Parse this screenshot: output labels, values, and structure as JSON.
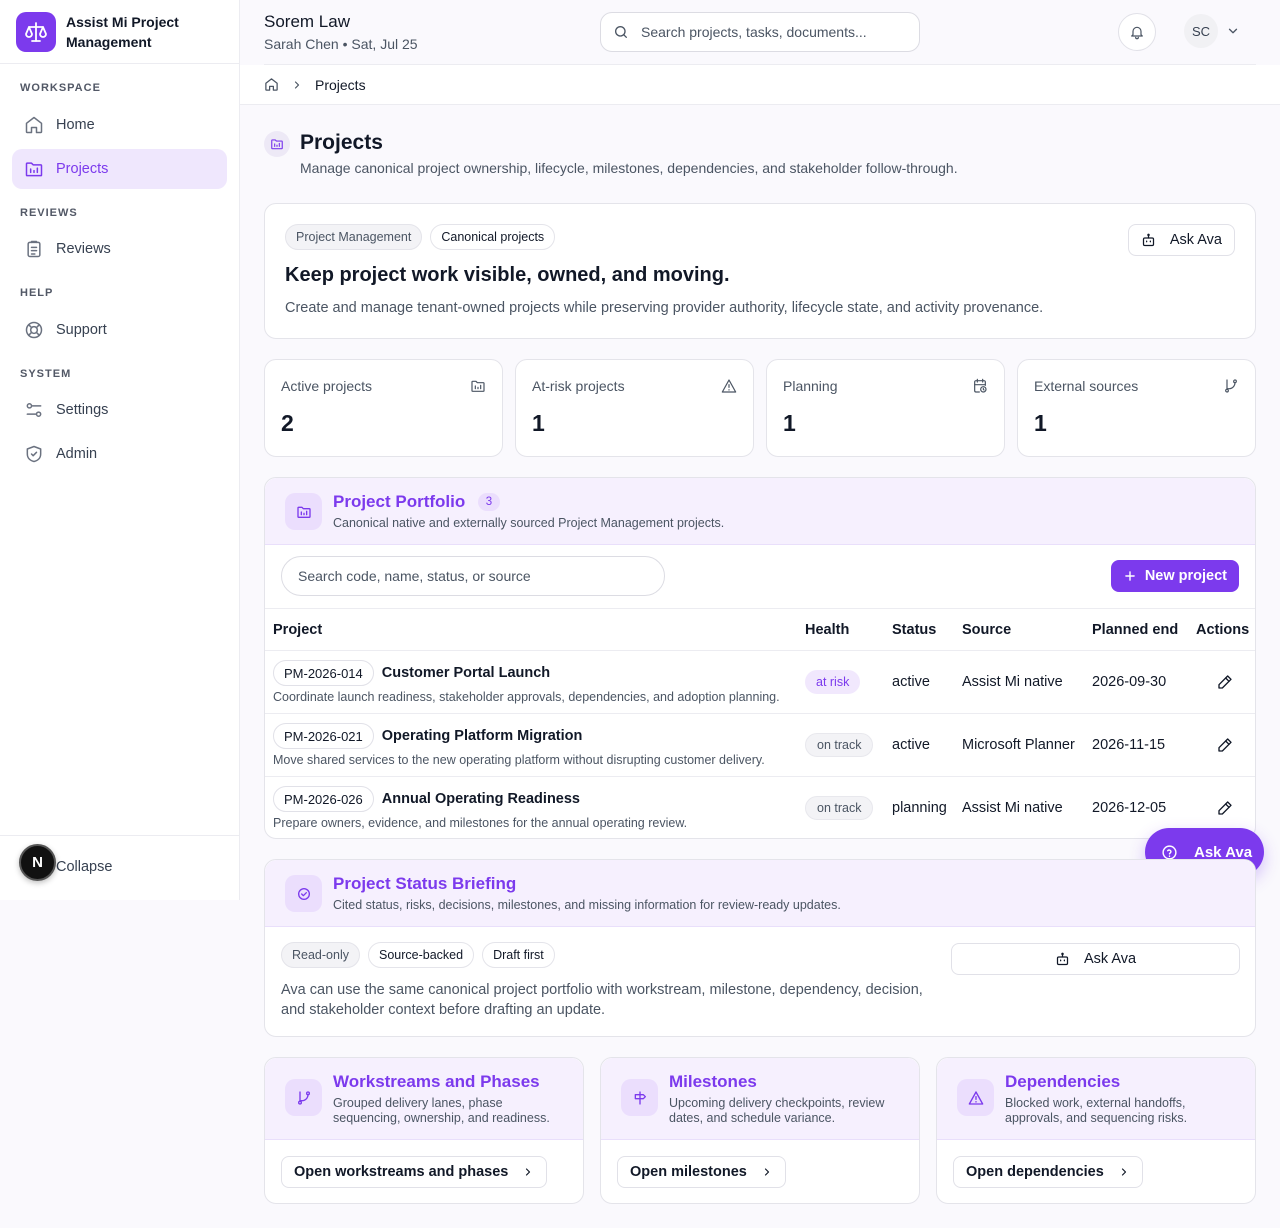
{
  "app": {
    "brand": "Assist Mi Project Management",
    "brand_color": "#7c3aed"
  },
  "sidebar": {
    "sections": [
      {
        "label": "WORKSPACE",
        "items": [
          {
            "label": "Home",
            "icon": "home-icon",
            "active": false
          },
          {
            "label": "Projects",
            "icon": "projects-icon",
            "active": true
          }
        ]
      },
      {
        "label": "REVIEWS",
        "items": [
          {
            "label": "Reviews",
            "icon": "clipboard-icon",
            "active": false
          }
        ]
      },
      {
        "label": "HELP",
        "items": [
          {
            "label": "Support",
            "icon": "lifebuoy-icon",
            "active": false
          }
        ]
      },
      {
        "label": "SYSTEM",
        "items": [
          {
            "label": "Settings",
            "icon": "settings-sliders-icon",
            "active": false
          },
          {
            "label": "Admin",
            "icon": "shield-icon",
            "active": false
          }
        ]
      }
    ],
    "collapse_label": "Collapse",
    "dev_badge": "N"
  },
  "header": {
    "org_name": "Sorem Law",
    "user_meta": "Sarah Chen • Sat, Jul 25",
    "search_placeholder": "Search projects, tasks, documents...",
    "user_initials": "SC"
  },
  "breadcrumb": {
    "current": "Projects"
  },
  "page": {
    "title": "Projects",
    "subtitle": "Manage canonical project ownership, lifecycle, milestones, dependencies, and stakeholder follow-through."
  },
  "hero": {
    "pills": [
      "Project Management",
      "Canonical projects"
    ],
    "heading": "Keep project work visible, owned, and moving.",
    "text": "Create and manage tenant-owned projects while preserving provider authority, lifecycle state, and activity provenance.",
    "ask_label": "Ask Ava"
  },
  "stats": [
    {
      "label": "Active projects",
      "value": "2",
      "icon": "projects-icon"
    },
    {
      "label": "At-risk projects",
      "value": "1",
      "icon": "warning-icon"
    },
    {
      "label": "Planning",
      "value": "1",
      "icon": "calendar-clock-icon"
    },
    {
      "label": "External sources",
      "value": "1",
      "icon": "branch-icon"
    }
  ],
  "portfolio": {
    "title": "Project Portfolio",
    "count": "3",
    "description": "Canonical native and externally sourced Project Management projects.",
    "search_placeholder": "Search code, name, status, or source",
    "new_label": "New project",
    "columns": [
      "Project",
      "Health",
      "Status",
      "Source",
      "Planned end",
      "Actions"
    ],
    "rows": [
      {
        "code": "PM-2026-014",
        "name": "Customer Portal Launch",
        "desc": "Coordinate launch readiness, stakeholder approvals, dependencies, and adoption planning.",
        "health": "at risk",
        "status": "active",
        "source": "Assist Mi native",
        "planned_end": "2026-09-30"
      },
      {
        "code": "PM-2026-021",
        "name": "Operating Platform Migration",
        "desc": "Move shared services to the new operating platform without disrupting customer delivery.",
        "health": "on track",
        "status": "active",
        "source": "Microsoft Planner",
        "planned_end": "2026-11-15"
      },
      {
        "code": "PM-2026-026",
        "name": "Annual Operating Readiness",
        "desc": "Prepare owners, evidence, and milestones for the annual operating review.",
        "health": "on track",
        "status": "planning",
        "source": "Assist Mi native",
        "planned_end": "2026-12-05"
      }
    ]
  },
  "floating_ask": {
    "label": "Ask Ava"
  },
  "briefing": {
    "title": "Project Status Briefing",
    "description": "Cited status, risks, decisions, milestones, and missing information for review-ready updates.",
    "pills": [
      "Read-only",
      "Source-backed",
      "Draft first"
    ],
    "ask_label": "Ask Ava",
    "text": "Ava can use the same canonical project portfolio with workstream, milestone, dependency, decision, and stakeholder context before drafting an update."
  },
  "bottom_cards": [
    {
      "title": "Workstreams and Phases",
      "description": "Grouped delivery lanes, phase sequencing, ownership, and readiness.",
      "link": "Open workstreams and phases",
      "icon": "branch-icon"
    },
    {
      "title": "Milestones",
      "description": "Upcoming delivery checkpoints, review dates, and schedule variance.",
      "link": "Open milestones",
      "icon": "signpost-icon"
    },
    {
      "title": "Dependencies",
      "description": "Blocked work, external handoffs, approvals, and sequencing risks.",
      "link": "Open dependencies",
      "icon": "warning-icon"
    }
  ]
}
